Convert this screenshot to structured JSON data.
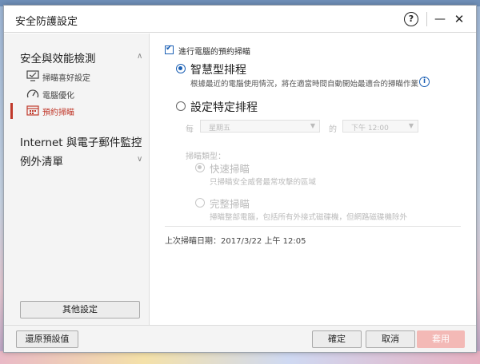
{
  "window": {
    "title": "安全防護設定",
    "help_glyph": "?",
    "minimize_glyph": "—",
    "close_glyph": "✕"
  },
  "sidebar": {
    "sections": [
      {
        "label": "安全與效能檢測",
        "chevron": "∧"
      },
      {
        "label": "Internet 與電子郵件監控",
        "chevron": "∨"
      },
      {
        "label": "例外清單",
        "chevron": "∨"
      }
    ],
    "items": [
      {
        "label": "掃瞄喜好設定",
        "icon": "monitor-scan-icon"
      },
      {
        "label": "電腦優化",
        "icon": "speedometer-icon"
      },
      {
        "label": "預約掃瞄",
        "icon": "calendar-icon",
        "active": true
      }
    ],
    "other_settings_label": "其他設定"
  },
  "main": {
    "schedule_checkbox_label": "進行電腦的預約掃瞄",
    "schedule_checked": true,
    "smart": {
      "label": "智慧型排程",
      "description": "根據最近的電腦使用情況，將在適當時間自動開始最適合的掃瞄作業",
      "info_glyph": "i"
    },
    "custom": {
      "label": "設定特定排程",
      "every_label": "每",
      "day_value": "星期五",
      "of_label": "的",
      "time_value": "下午 12:00",
      "scan_type_label": "掃瞄類型：",
      "quick": {
        "label": "快速掃瞄",
        "description": "只掃瞄安全威脅最常攻擊的區域"
      },
      "full": {
        "label": "完整掃瞄",
        "description": "掃瞄整部電腦，包括所有外接式磁碟機，但網路磁碟機除外"
      }
    },
    "last_scan": "上次掃瞄日期：2017/3/22 上午 12:05"
  },
  "footer": {
    "restore_label": "還原預設值",
    "ok_label": "確定",
    "cancel_label": "取消",
    "apply_label": "套用"
  },
  "colors": {
    "accent": "#1a5fb4",
    "active_red": "#c0392b",
    "disabled_apply": "#f3b9b6"
  }
}
